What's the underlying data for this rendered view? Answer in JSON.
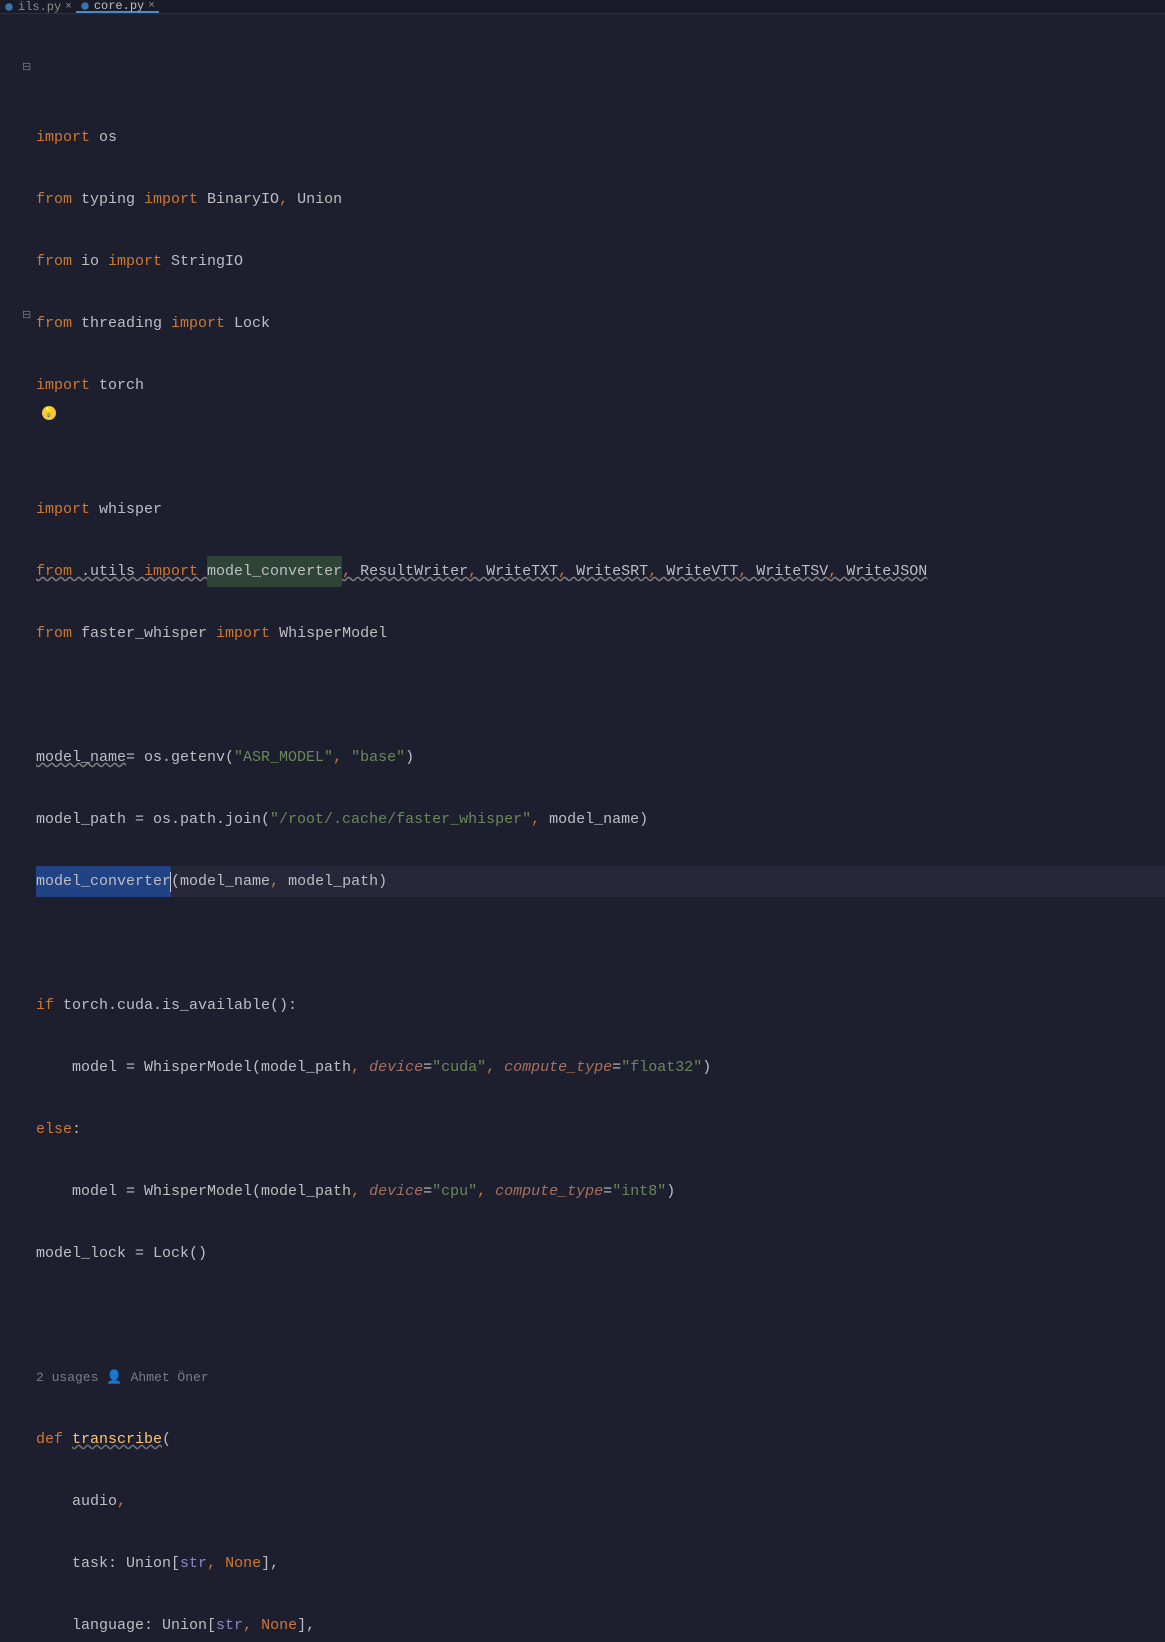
{
  "tabs": [
    {
      "label": "ils.py",
      "active": false
    },
    {
      "label": "core.py",
      "active": true
    }
  ],
  "inlay": {
    "usages": "2 usages",
    "author": "Ahmet Öner"
  },
  "code": {
    "l1": {
      "kw": "import ",
      "id1": "os"
    },
    "l2": {
      "kw1": "from ",
      "id1": "typing",
      "kw2": " import ",
      "id2": "BinaryIO",
      "c": ", ",
      "id3": "Union"
    },
    "l3": {
      "kw1": "from ",
      "id1": "io",
      "kw2": " import ",
      "id2": "StringIO"
    },
    "l4": {
      "kw1": "from ",
      "id1": "threading",
      "kw2": " import ",
      "id2": "Lock"
    },
    "l5": {
      "kw": "import ",
      "id1": "torch"
    },
    "l6": {
      "blank": ""
    },
    "l7": {
      "kw": "import ",
      "id1": "whisper"
    },
    "l8": {
      "kw1": "from ",
      "id1": ".utils",
      "kw2": " import ",
      "hl": "model_converter",
      "c1": ", ",
      "i2": "ResultWriter",
      "c2": ", ",
      "i3": "WriteTXT",
      "c3": ", ",
      "i4": "WriteSRT",
      "c4": ", ",
      "i5": "WriteVTT",
      "c5": ", ",
      "i6": "WriteTSV",
      "c6": ", ",
      "i7": "WriteJSON"
    },
    "l9": {
      "kw1": "from ",
      "id1": "faster_whisper",
      "kw2": " import ",
      "id2": "WhisperModel"
    },
    "l10": {
      "blank": ""
    },
    "l11": {
      "id1": "model_name",
      "op": "= ",
      "id2": "os.getenv(",
      "s1": "\"ASR_MODEL\"",
      "c": ", ",
      "s2": "\"base\"",
      "p": ")"
    },
    "l12": {
      "id1": "model_path = os.path.join(",
      "s1": "\"/root/.cache/faster_whisper\"",
      "c": ", ",
      "id2": "model_name)"
    },
    "l13": {
      "hl": "model_converter",
      "rest": "(model_name",
      "c": ", ",
      "rest2": "model_path)"
    },
    "l14": {
      "blank": ""
    },
    "l15": {
      "kw": "if ",
      "id": "torch.cuda.is_available():"
    },
    "l16": {
      "indent": "    ",
      "id1": "model = WhisperModel(model_path",
      "c1": ", ",
      "sk1": "device",
      "op1": "=",
      "s1": "\"cuda\"",
      "c2": ", ",
      "sk2": "compute_type",
      "op2": "=",
      "s2": "\"float32\"",
      "p": ")"
    },
    "l17": {
      "kw": "else",
      "p": ":"
    },
    "l18": {
      "indent": "    ",
      "id1": "model = WhisperModel(model_path",
      "c1": ", ",
      "sk1": "device",
      "op1": "=",
      "s1": "\"cpu\"",
      "c2": ", ",
      "sk2": "compute_type",
      "op2": "=",
      "s2": "\"int8\"",
      "p": ")"
    },
    "l19": {
      "id": "model_lock = Lock()"
    },
    "l20": {
      "blank": ""
    },
    "l22": {
      "kw": "def ",
      "fn": "transcribe",
      "p": "("
    },
    "l23": {
      "indent": "    ",
      "id": "audio",
      "c": ","
    },
    "l24": {
      "indent": "    ",
      "id1": "task: Union[",
      "t": "str",
      "c": ", ",
      "n": "None",
      "p": "],"
    },
    "l25": {
      "indent": "    ",
      "id1": "language: Union[",
      "t": "str",
      "c": ", ",
      "n": "None",
      "p": "],"
    }
  }
}
